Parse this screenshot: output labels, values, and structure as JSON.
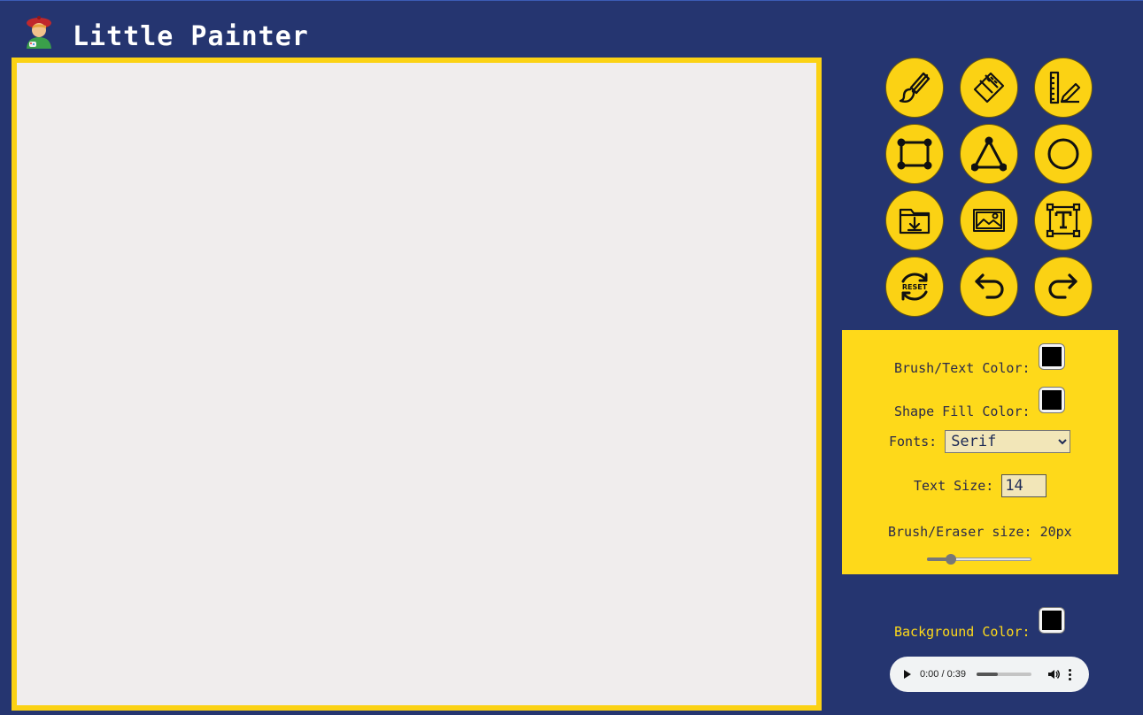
{
  "app": {
    "title": "Little Painter"
  },
  "tools": [
    {
      "name": "brush-icon"
    },
    {
      "name": "eraser-icon"
    },
    {
      "name": "ruler-pencil-icon"
    },
    {
      "name": "rectangle-icon"
    },
    {
      "name": "triangle-icon"
    },
    {
      "name": "circle-icon"
    },
    {
      "name": "save-folder-icon"
    },
    {
      "name": "image-icon"
    },
    {
      "name": "text-box-icon"
    },
    {
      "name": "reset-icon"
    },
    {
      "name": "undo-icon"
    },
    {
      "name": "redo-icon"
    }
  ],
  "panel": {
    "brush_text_color_label": "Brush/Text Color:",
    "brush_text_color": "#000000",
    "shape_fill_color_label": "Shape Fill Color:",
    "shape_fill_color": "#000000",
    "fonts_label": "Fonts:",
    "font_selected": "Serif",
    "text_size_label": "Text Size:",
    "text_size": "14",
    "brush_size_label": "Brush/Eraser size: 20px",
    "brush_size_fraction": 0.2
  },
  "background": {
    "label": "Background Color:",
    "color": "#000000"
  },
  "audio": {
    "time": "0:00 / 0:39",
    "progress_fraction": 0.38
  },
  "colors": {
    "page_bg": "#253570",
    "accent_yellow": "#fed91a",
    "canvas_bg": "#f0eded"
  },
  "reset_text": "RESET"
}
